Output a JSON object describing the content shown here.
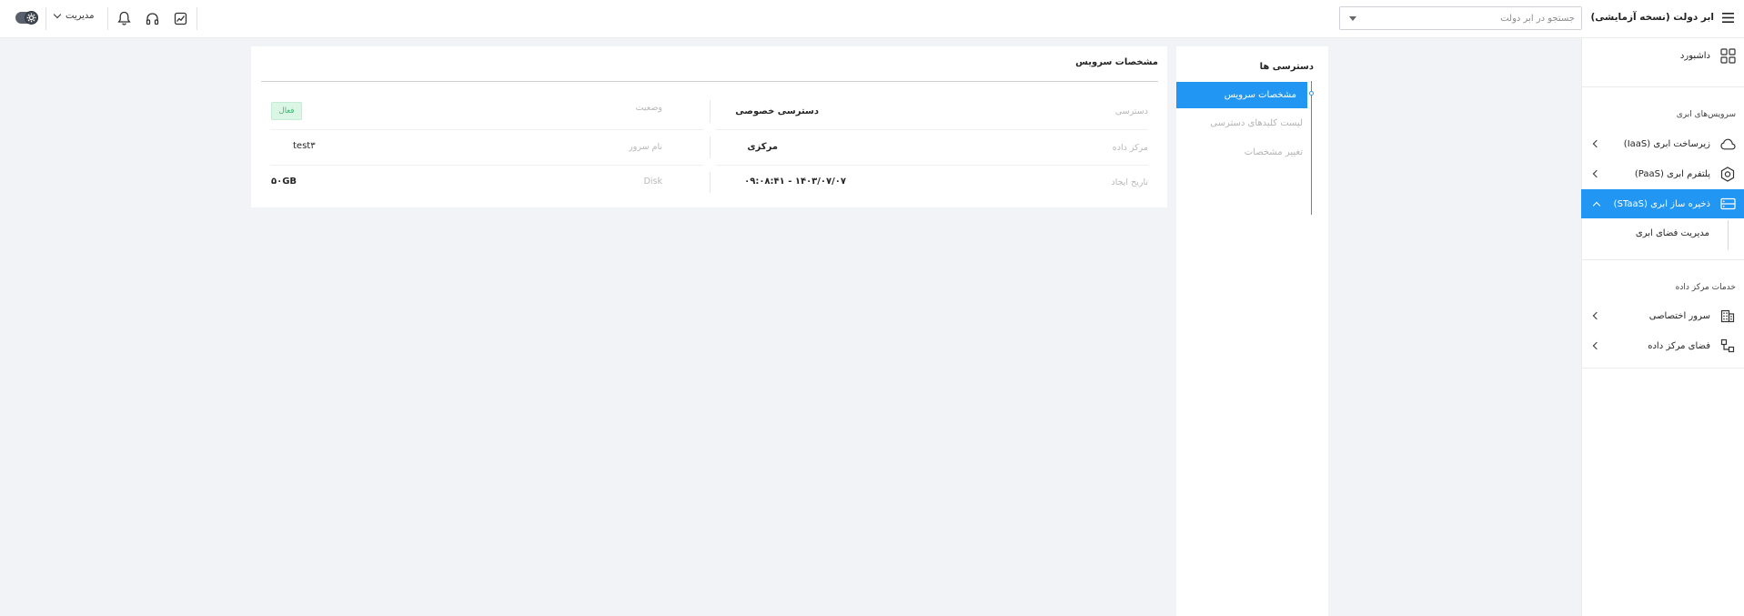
{
  "app": {
    "title": "ابر دولت (نسخه آزمایشی)"
  },
  "header": {
    "search_placeholder": "جستجو در ابر دولت",
    "user_menu_label": "مدیریت",
    "icons": [
      "menu-icon",
      "settings-toggle-icon",
      "bell-icon",
      "headphones-icon",
      "chart-icon"
    ]
  },
  "sidebar": {
    "dashboard": "داشبورد",
    "group_cloud": "سرویس‌های ابری",
    "iaas": "زیرساخت ابری (IaaS)",
    "paas": "پلتفرم ابری (PaaS)",
    "staas": "ذخیره ساز ابری (STaaS)",
    "staas_sub": "مدیریت فضای ابری",
    "group_datacenter": "خدمات مرکز داده",
    "dedicated": "سرور اختصاصی",
    "colocation": "فضای مرکز داده"
  },
  "access_panel": {
    "title": "دسترسی ها",
    "items": [
      "مشخصات سرویس",
      "لیست کلیدهای دسترسی",
      "تغییر مشخصات"
    ]
  },
  "service": {
    "title": "مشخصات سرویس",
    "rows": [
      {
        "label_right": "دسترسی",
        "value_right": "دسترسی خصوصی",
        "label_left": "وضعیت",
        "value_left": "فعال"
      },
      {
        "label_right": "مرکز داده",
        "value_right": "مرکزی",
        "label_left": "نام سرور",
        "value_left": "test۳"
      },
      {
        "label_right": "تاریخ ایجاد",
        "value_right": "۱۴۰۳/۰۷/۰۷ - ۰۹:۰۸:۴۱",
        "label_left": "Disk",
        "value_left": "۵۰GB"
      }
    ]
  },
  "colors": {
    "accent": "#2196f3",
    "status_active_bg": "#dcf6e6",
    "status_active_fg": "#3cb971"
  }
}
